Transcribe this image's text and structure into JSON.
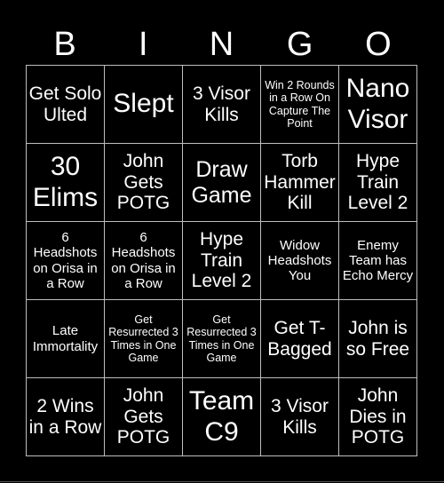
{
  "header": {
    "letters": [
      "B",
      "I",
      "N",
      "G",
      "O"
    ]
  },
  "cells": [
    {
      "text": "Get Solo Ulted",
      "size": "md"
    },
    {
      "text": "Slept",
      "size": "xl"
    },
    {
      "text": "3 Visor Kills",
      "size": "md"
    },
    {
      "text": "Win 2 Rounds in a Row On Capture The Point",
      "size": "xxs"
    },
    {
      "text": "Nano Visor",
      "size": "xl"
    },
    {
      "text": "30 Elims",
      "size": "xl"
    },
    {
      "text": "John Gets POTG",
      "size": "md"
    },
    {
      "text": "Draw Game",
      "size": "lg"
    },
    {
      "text": "Torb Hammer Kill",
      "size": "md"
    },
    {
      "text": "Hype Train Level 2",
      "size": "md"
    },
    {
      "text": "6 Headshots on Orisa in a Row",
      "size": "xs"
    },
    {
      "text": "6 Headshots on Orisa in a Row",
      "size": "xs"
    },
    {
      "text": "Hype Train Level 2",
      "size": "md"
    },
    {
      "text": "Widow Headshots You",
      "size": "xs"
    },
    {
      "text": "Enemy Team has Echo Mercy",
      "size": "xs"
    },
    {
      "text": "Late Immortality",
      "size": "xs"
    },
    {
      "text": "Get Resurrected 3 Times in One Game",
      "size": "xxs"
    },
    {
      "text": "Get Resurrected 3 Times in One Game",
      "size": "xxs"
    },
    {
      "text": "Get T-Bagged",
      "size": "md"
    },
    {
      "text": "John is so Free",
      "size": "md"
    },
    {
      "text": "2 Wins in a Row",
      "size": "md"
    },
    {
      "text": "John Gets POTG",
      "size": "md"
    },
    {
      "text": "Team C9",
      "size": "xl"
    },
    {
      "text": "3 Visor Kills",
      "size": "md"
    },
    {
      "text": "John Dies in POTG",
      "size": "md"
    }
  ]
}
